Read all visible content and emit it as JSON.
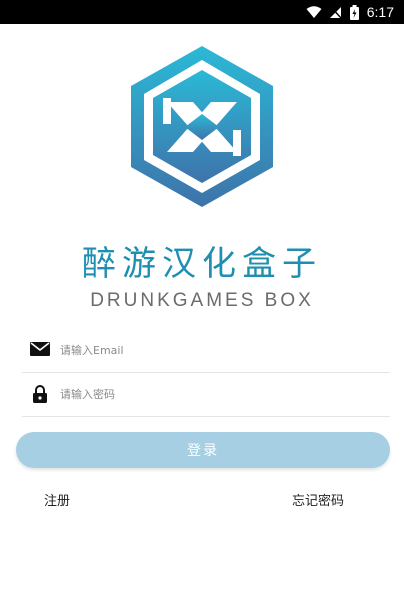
{
  "status_bar": {
    "time": "6:17",
    "icons": [
      "wifi-icon",
      "cellular-icon",
      "battery-charging-icon"
    ]
  },
  "app": {
    "title": "醉游汉化盒子",
    "subtitle": "DRUNKGAMES BOX",
    "brand_color": "#1e8fb1"
  },
  "form": {
    "email_placeholder": "请输入Email",
    "password_placeholder": "请输入密码",
    "email_value": "",
    "password_value": "",
    "login_label": "登录",
    "login_button_color": "#a7cfe3"
  },
  "links": {
    "register": "注册",
    "forgot_password": "忘记密码"
  }
}
